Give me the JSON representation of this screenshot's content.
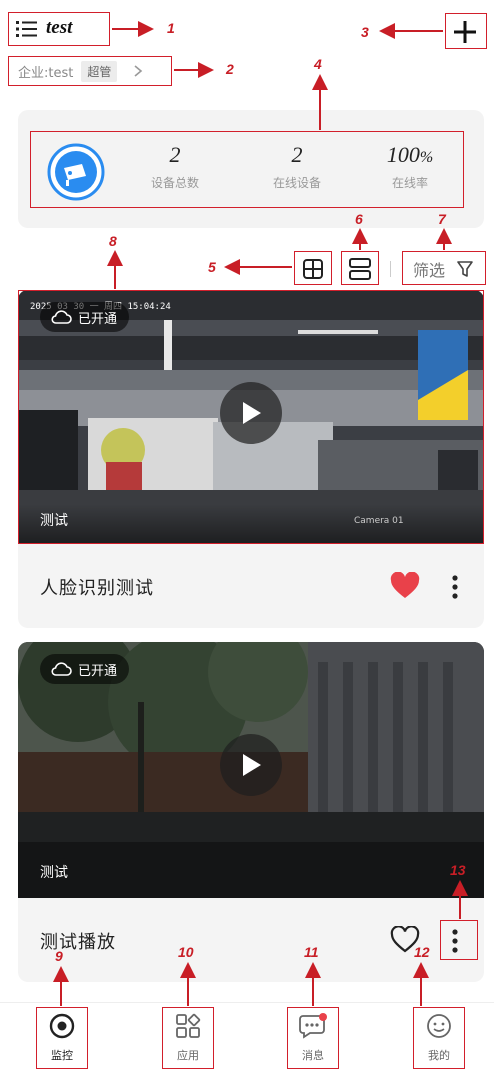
{
  "header": {
    "title": "test",
    "company_label": "企业:test",
    "role_badge": "超管"
  },
  "stats": {
    "total_value": "2",
    "total_label": "设备总数",
    "online_value": "2",
    "online_label": "在线设备",
    "rate_value": "100",
    "rate_unit": "%",
    "rate_label": "在线率"
  },
  "toolbar": {
    "filter_label": "筛选"
  },
  "devices": [
    {
      "cloud_status": "已开通",
      "camera_name": "测试",
      "osd_timestamp": "2025 03 30 一 周四 15:04:24",
      "osd_camera": "Camera 01",
      "device_name": "人脸识别测试",
      "favorited": true
    },
    {
      "cloud_status": "已开通",
      "camera_name": "测试",
      "device_name": "测试播放",
      "favorited": false
    }
  ],
  "nav": {
    "items": [
      {
        "label": "监控",
        "icon": "monitor-icon",
        "active": true
      },
      {
        "label": "应用",
        "icon": "apps-icon",
        "active": false
      },
      {
        "label": "消息",
        "icon": "message-icon",
        "active": false
      },
      {
        "label": "我的",
        "icon": "profile-icon",
        "active": false
      }
    ]
  },
  "annotations": [
    "1",
    "2",
    "3",
    "4",
    "5",
    "6",
    "7",
    "8",
    "9",
    "10",
    "11",
    "12",
    "13"
  ],
  "colors": {
    "accent_blue": "#2a8cf0",
    "favorite_red": "#e9414a",
    "annotation_red": "#c81e26"
  }
}
